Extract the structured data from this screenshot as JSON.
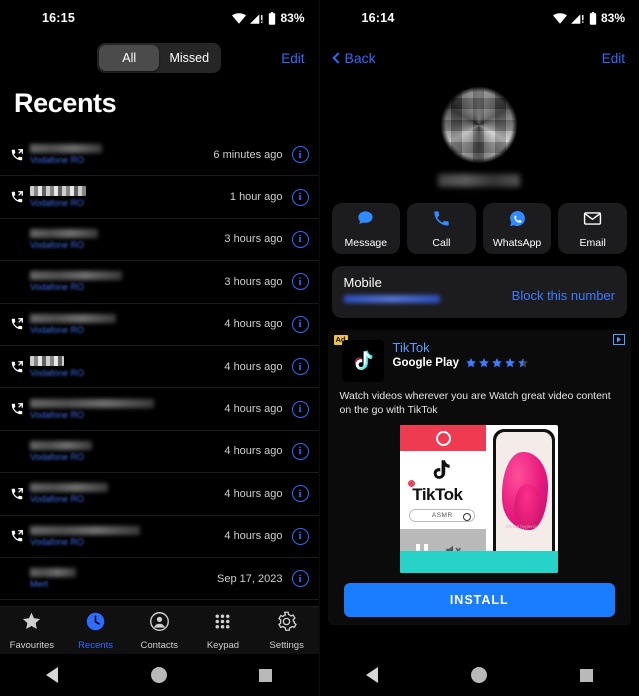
{
  "left": {
    "status": {
      "time": "16:15",
      "battery": "83%",
      "wifi_icon": "wifi-icon",
      "signal_icon": "signal-icon",
      "battery_icon": "battery-icon"
    },
    "segmented": {
      "all": "All",
      "missed": "Missed",
      "selected": "All"
    },
    "edit_label": "Edit",
    "page_title": "Recents",
    "calls": [
      {
        "name": "",
        "subtitle": "Vodafone RO",
        "time": "6 minutes ago",
        "icon": "outgoing-call-icon",
        "redacted": "blur"
      },
      {
        "name": "",
        "subtitle": "Vodafone RO",
        "time": "1 hour ago",
        "icon": "outgoing-call-icon",
        "redacted": "pixel"
      },
      {
        "name": "",
        "subtitle": "Vodafone RO",
        "time": "3 hours ago",
        "icon": "",
        "redacted": "blur"
      },
      {
        "name": "",
        "subtitle": "Vodafone RO",
        "time": "3 hours ago",
        "icon": "",
        "redacted": "blur"
      },
      {
        "name": "",
        "subtitle": "Vodafone RO",
        "time": "4 hours ago",
        "icon": "outgoing-call-icon",
        "redacted": "blur"
      },
      {
        "name": "",
        "subtitle": "Vodafone RO",
        "time": "4 hours ago",
        "icon": "outgoing-call-icon",
        "redacted": "pixel"
      },
      {
        "name": "",
        "subtitle": "Vodafone RO",
        "time": "4 hours ago",
        "icon": "outgoing-call-icon",
        "redacted": "blur"
      },
      {
        "name": "",
        "subtitle": "Vodafone RO",
        "time": "4 hours ago",
        "icon": "",
        "redacted": "blur"
      },
      {
        "name": "",
        "subtitle": "Vodafone RO",
        "time": "4 hours ago",
        "icon": "outgoing-call-icon",
        "redacted": "blur"
      },
      {
        "name": "",
        "subtitle": "Vodafone RO",
        "time": "4 hours ago",
        "icon": "outgoing-call-icon",
        "redacted": "blur"
      },
      {
        "name": "",
        "subtitle": "Mert",
        "time": "Sep 17, 2023",
        "icon": "",
        "redacted": "blur"
      },
      {
        "name": "",
        "subtitle": "",
        "time": "",
        "icon": "",
        "redacted": "blur"
      }
    ],
    "tabs": [
      {
        "label": "Favourites",
        "icon": "star-icon",
        "active": false
      },
      {
        "label": "Recents",
        "icon": "clock-icon",
        "active": true
      },
      {
        "label": "Contacts",
        "icon": "person-circle-icon",
        "active": false
      },
      {
        "label": "Keypad",
        "icon": "keypad-grid-icon",
        "active": false
      },
      {
        "label": "Settings",
        "icon": "gear-icon",
        "active": false
      }
    ]
  },
  "right": {
    "status": {
      "time": "16:14",
      "battery": "83%"
    },
    "back_label": "Back",
    "edit_label": "Edit",
    "contact": {
      "name": "",
      "avatar": "pixelated-avatar"
    },
    "actions": [
      {
        "label": "Message",
        "icon": "message-bubble-icon"
      },
      {
        "label": "Call",
        "icon": "phone-icon"
      },
      {
        "label": "WhatsApp",
        "icon": "whatsapp-icon"
      },
      {
        "label": "Email",
        "icon": "envelope-icon"
      }
    ],
    "number_card": {
      "label": "Mobile",
      "number": "",
      "block_label": "Block this number"
    },
    "ad": {
      "badge": "Ad",
      "adchoices_icon": "adchoices-icon",
      "title": "TikTok",
      "store": "Google Play",
      "rating": 4.5,
      "description": "Watch videos wherever you are Watch great video content on the go with TikTok",
      "creative": {
        "wordmark": "TikTok",
        "search_text": "ASMR",
        "caption": "it's not hygienic"
      },
      "install_label": "INSTALL"
    }
  },
  "nav": {
    "back": "nav-back-icon",
    "home": "nav-home-icon",
    "recents": "nav-recents-icon"
  },
  "colors": {
    "accent_blue": "#2f6bff",
    "link_blue": "#3b7bff",
    "ad_badge": "#f2c14b",
    "install_blue": "#1a7cff"
  }
}
